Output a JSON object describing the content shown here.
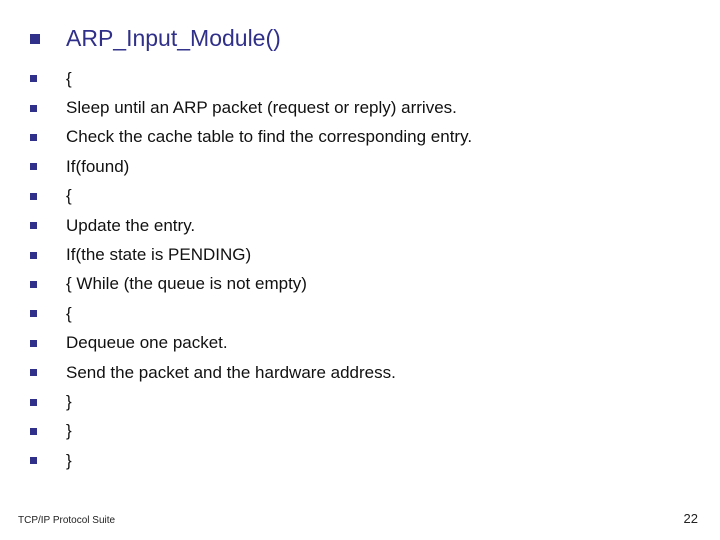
{
  "title": "ARP_Input_Module()",
  "lines": [
    "{",
    "Sleep until an ARP packet (request or reply) arrives.",
    "Check the cache table to find the corresponding entry.",
    "If(found)",
    "{",
    "Update the entry.",
    "If(the state is PENDING)",
    "{ While (the queue is not empty)",
    "{",
    "Dequeue one packet.",
    "Send the packet and the hardware address.",
    "}",
    "}",
    "}"
  ],
  "footer_left": "TCP/IP Protocol Suite",
  "footer_right": "22"
}
